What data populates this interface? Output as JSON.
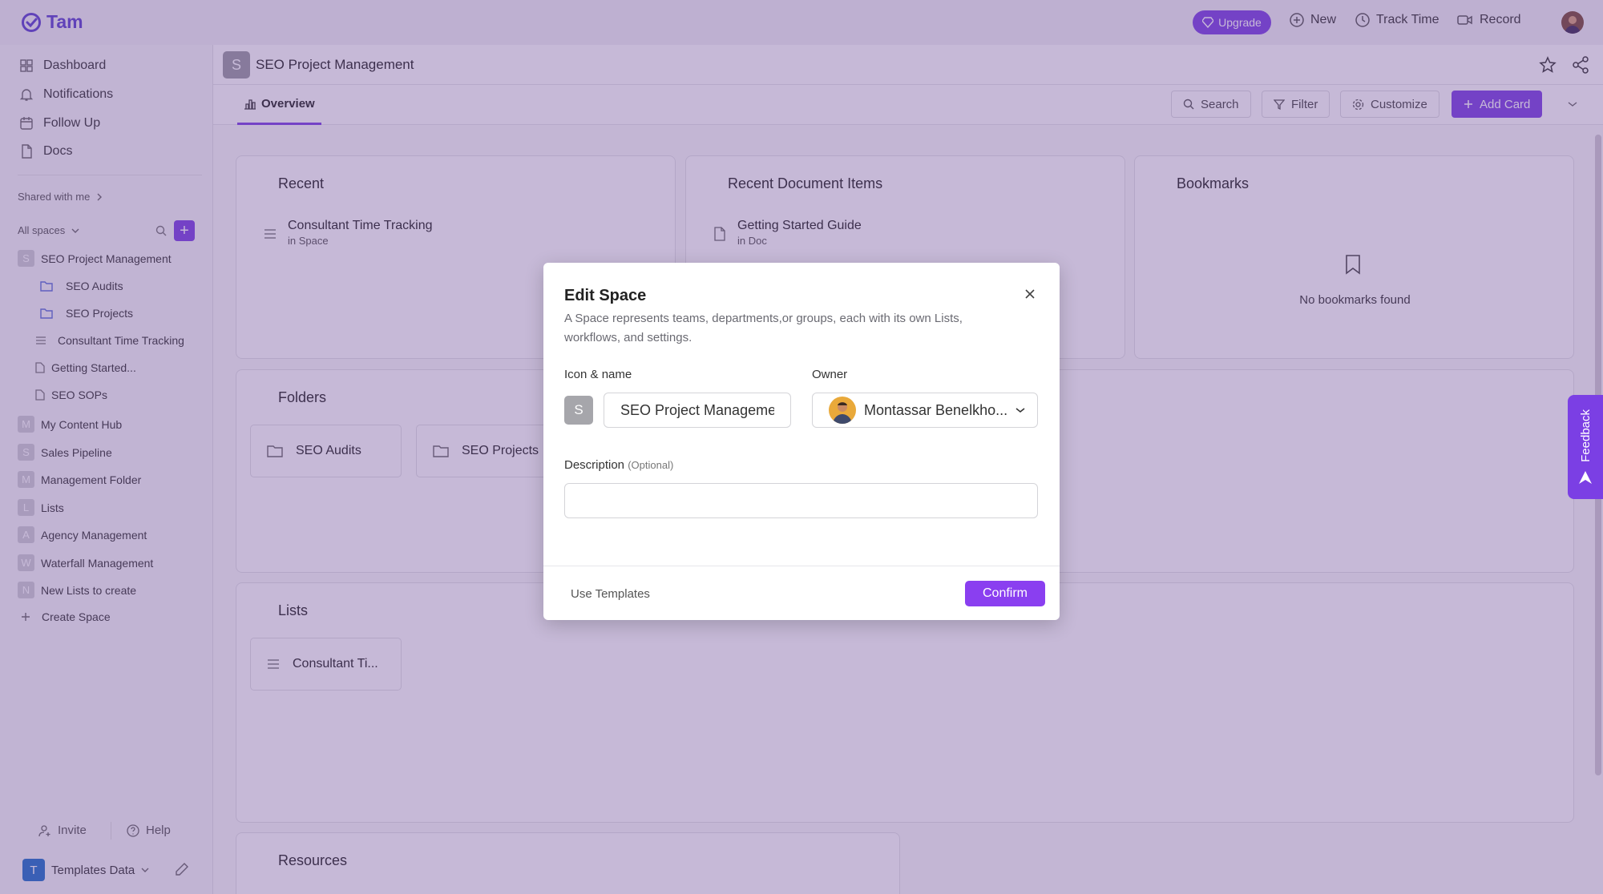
{
  "app": {
    "logo_text": "Tam"
  },
  "topbar": {
    "upgrade": "Upgrade",
    "new": "New",
    "track_time": "Track Time",
    "record": "Record"
  },
  "sidebar": {
    "nav": [
      "Dashboard",
      "Notifications",
      "Follow Up",
      "Docs"
    ],
    "shared_label": "Shared with me",
    "all_spaces_label": "All spaces",
    "tree": [
      {
        "label": "SEO Project Management",
        "badge": "S"
      },
      {
        "label": "SEO Audits"
      },
      {
        "label": "SEO Projects"
      },
      {
        "label": "Consultant Time Tracking"
      },
      {
        "label": "Getting Started..."
      },
      {
        "label": "SEO SOPs"
      },
      {
        "label": "My Content Hub",
        "badge": "M"
      },
      {
        "label": "Sales Pipeline",
        "badge": "S"
      },
      {
        "label": "Management Folder",
        "badge": "M"
      },
      {
        "label": "Lists",
        "badge": "L"
      },
      {
        "label": "Agency Management",
        "badge": "A"
      },
      {
        "label": "Waterfall Management",
        "badge": "W"
      },
      {
        "label": "New Lists to create",
        "badge": "N"
      }
    ],
    "create_space": "Create Space",
    "invite": "Invite",
    "help": "Help",
    "workspace": {
      "badge": "T",
      "name": "Templates Data"
    }
  },
  "header": {
    "badge": "S",
    "title": "SEO Project Management"
  },
  "tabs": {
    "overview": "Overview"
  },
  "toolbar": {
    "search": "Search",
    "filter": "Filter",
    "customize": "Customize",
    "add_card": "Add Card"
  },
  "cards": {
    "recent": {
      "title": "Recent",
      "item_title": "Consultant Time Tracking",
      "item_sub": "in Space"
    },
    "recent_docs": {
      "title": "Recent Document Items",
      "item_title": "Getting Started Guide",
      "item_sub": "in Doc"
    },
    "bookmarks": {
      "title": "Bookmarks",
      "empty": "No bookmarks found"
    },
    "folders": {
      "title": "Folders",
      "items": [
        "SEO Audits",
        "SEO Projects"
      ]
    },
    "lists": {
      "title": "Lists",
      "items": [
        "Consultant Ti..."
      ]
    },
    "resources": {
      "title": "Resources"
    }
  },
  "modal": {
    "title": "Edit Space",
    "description": "A Space represents teams, departments,or groups, each with its own Lists, workflows, and settings.",
    "icon_name_label": "Icon & name",
    "icon_letter": "S",
    "name_value": "SEO Project Managemer",
    "owner_label": "Owner",
    "owner_name": "Montassar Benelkho...",
    "description_label": "Description",
    "optional": "(Optional)",
    "description_value": "",
    "use_templates": "Use Templates",
    "confirm": "Confirm"
  },
  "feedback": "Feedback",
  "colors": {
    "accent": "#7b3fe4",
    "confirm": "#8a3ff0",
    "overlay": "#684896"
  }
}
